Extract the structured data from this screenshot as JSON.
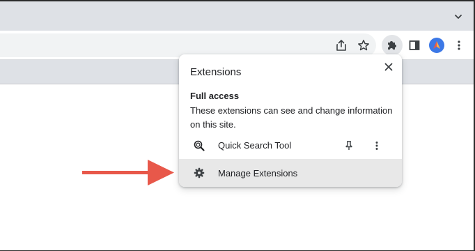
{
  "tabstrip": {
    "tab_search_icon": "chevron-down-icon"
  },
  "toolbar": {
    "share_icon": "share-icon",
    "bookmark_icon": "star-icon",
    "extensions_icon": "puzzle-icon",
    "side_panel_icon": "side-panel-icon",
    "profile_icon": "avatar",
    "menu_icon": "kebab-icon"
  },
  "popup": {
    "title": "Extensions",
    "section_heading": "Full access",
    "section_description": "These extensions can see and change information on this site.",
    "extensions": [
      {
        "name": "Quick Search Tool",
        "icon": "magnifier-icon",
        "pinned": false
      }
    ],
    "manage_label": "Manage Extensions"
  },
  "annotation": {
    "arrow_color": "#e8584a"
  },
  "colors": {
    "tabstrip": "#dee1e6",
    "omnibox": "#f1f3f4",
    "hover_row": "#e8e8e8",
    "avatar": "#3c78e6"
  }
}
